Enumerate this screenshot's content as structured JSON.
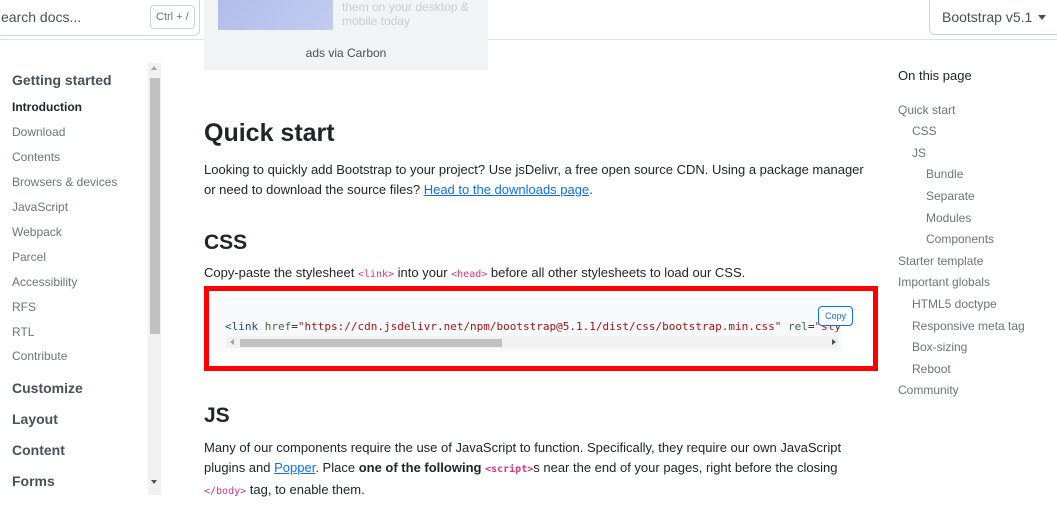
{
  "topbar": {
    "search_placeholder": "earch docs...",
    "search_shortcut": "Ctrl + /",
    "version_label": "Bootstrap v5.1"
  },
  "ad": {
    "text": "them on your desktop & mobile today",
    "via": "ads via Carbon"
  },
  "sidebar": {
    "groups": {
      "getting_started": "Getting started",
      "customize": "Customize",
      "layout": "Layout",
      "content": "Content",
      "forms": "Forms"
    },
    "items": [
      "Introduction",
      "Download",
      "Contents",
      "Browsers & devices",
      "JavaScript",
      "Webpack",
      "Parcel",
      "Accessibility",
      "RFS",
      "RTL",
      "Contribute"
    ],
    "active_item": "Introduction"
  },
  "main": {
    "quick_start": {
      "heading": "Quick start",
      "text_before": "Looking to quickly add Bootstrap to your project? Use jsDelivr, a free open source CDN. Using a package manager or need to download the source files? ",
      "link": "Head to the downloads page",
      "text_after": "."
    },
    "css": {
      "heading": "CSS",
      "text_1": "Copy-paste the stylesheet ",
      "code_1": "<link>",
      "text_2": " into your ",
      "code_2": "<head>",
      "text_3": " before all other stylesheets to load our CSS.",
      "code_line": {
        "tag_open": "<link",
        "attr_href": " href",
        "eq": "=",
        "href_value": "\"https://cdn.jsdelivr.net/npm/bootstrap@5.1.1/dist/css/bootstrap.min.css\"",
        "attr_rel": " rel",
        "rel_value": "\"sty"
      },
      "copy_label": "Copy"
    },
    "js": {
      "heading": "JS",
      "text_1": "Many of our components require the use of JavaScript to function. Specifically, they require our own JavaScript plugins and ",
      "link": "Popper",
      "text_2": ". Place ",
      "bold": "one of the following",
      "code_1": "<script>",
      "text_3": "s near the end of your pages, right before the closing ",
      "code_2": "</body>",
      "text_4": " tag, to enable them."
    }
  },
  "toc": {
    "title": "On this page",
    "links": [
      "Quick start",
      "CSS",
      "JS",
      "Bundle",
      "Separate",
      "Modules",
      "Components",
      "Starter template",
      "Important globals",
      "HTML5 doctype",
      "Responsive meta tag",
      "Box-sizing",
      "Reboot",
      "Community"
    ]
  },
  "colors": {
    "highlight_border": "#ff0000",
    "link": "#0d6efd",
    "code_tag": "#d63384"
  }
}
